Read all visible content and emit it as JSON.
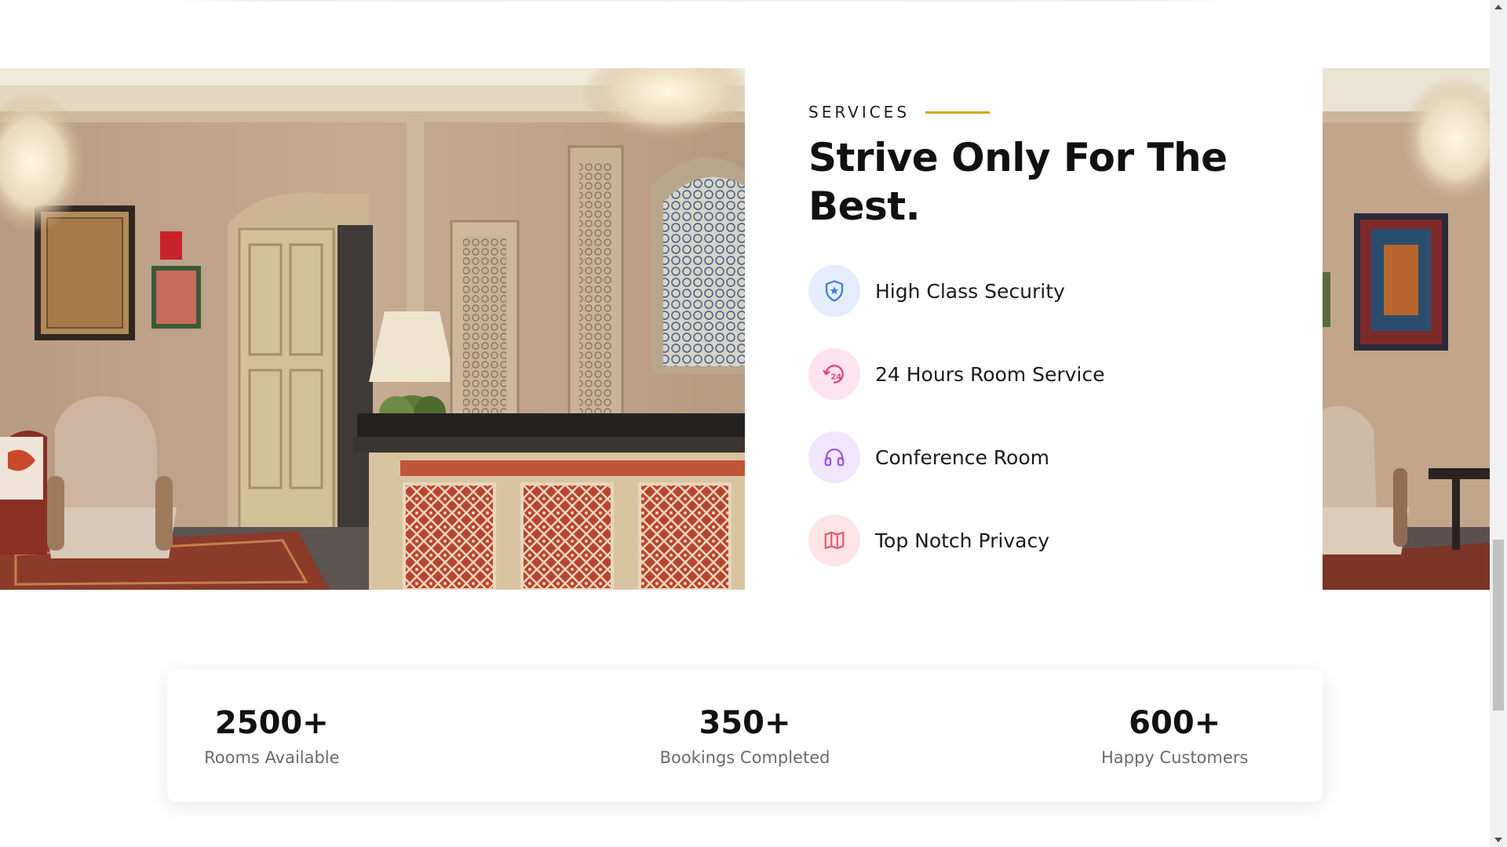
{
  "services": {
    "eyebrow": "SERVICES",
    "heading": "Strive Only For The Best.",
    "accent_color": "#d9a31b",
    "items": [
      {
        "label": "High Class Security",
        "icon": "shield-star-icon",
        "icon_bg": "#e3edfd",
        "icon_color": "#3d7be0"
      },
      {
        "label": "24 Hours Room Service",
        "icon": "clock-24-icon",
        "icon_bg": "#fde3ef",
        "icon_color": "#e2447f"
      },
      {
        "label": "Conference Room",
        "icon": "headphones-icon",
        "icon_bg": "#f1e6fd",
        "icon_color": "#9a52e6"
      },
      {
        "label": "Top Notch Privacy",
        "icon": "map-icon",
        "icon_bg": "#fde4e6",
        "icon_color": "#e35d6e"
      }
    ]
  },
  "stats": [
    {
      "value": "2500+",
      "label": "Rooms Available"
    },
    {
      "value": "350+",
      "label": "Bookings Completed"
    },
    {
      "value": "600+",
      "label": "Happy Customers"
    }
  ],
  "images": {
    "left": "hotel-lobby-reception-photo",
    "right": "hotel-lounge-photo"
  }
}
